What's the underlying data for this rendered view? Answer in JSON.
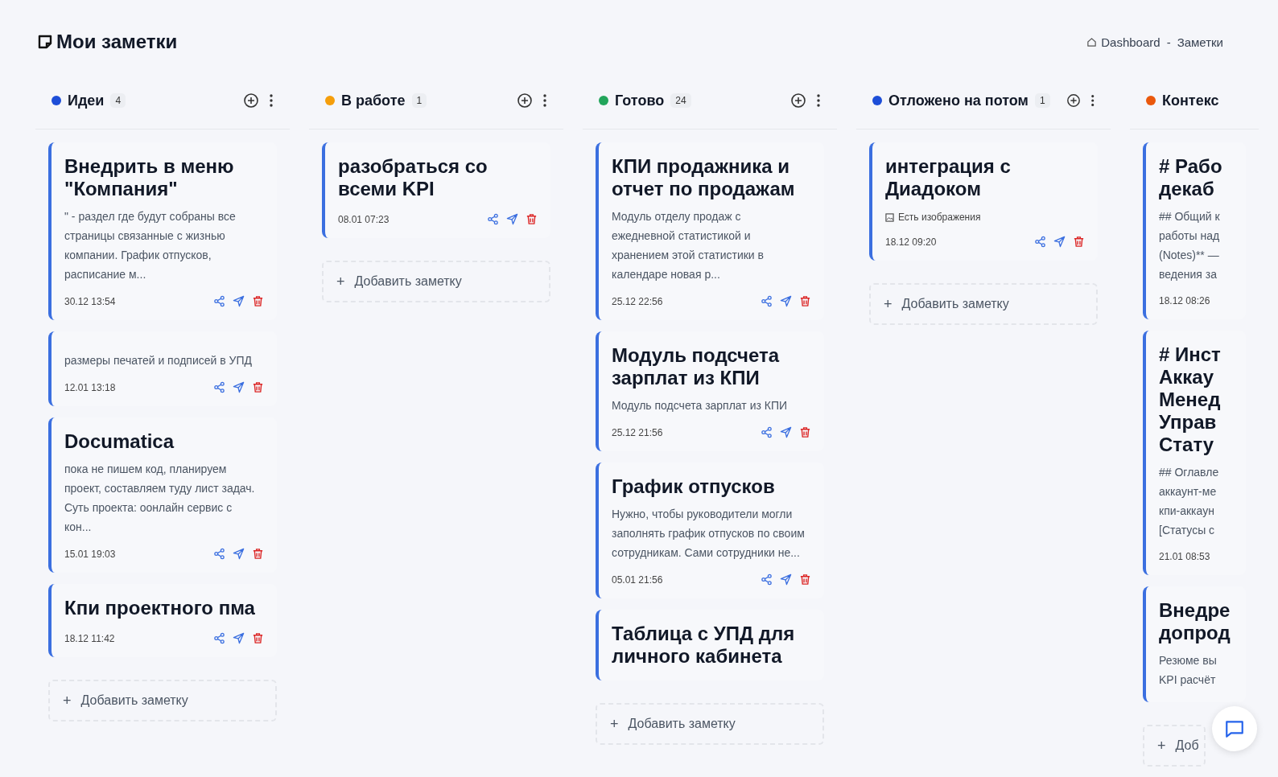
{
  "page": {
    "title": "Мои заметки"
  },
  "breadcrumb": [
    {
      "label": "Dashboard",
      "kind": "home"
    },
    {
      "label": "-",
      "kind": "separator"
    },
    {
      "label": "Заметки",
      "kind": "current"
    }
  ],
  "columns": [
    {
      "title": "Идеи",
      "count": "4",
      "color": "#1d4ed8",
      "add_label": "+",
      "add_text": "Добавить заметку",
      "cards": [
        {
          "title": "Внедрить в меню \"Компания\"",
          "preview": "\" - раздел где будут собраны все страницы связанные с жизнью компании. График отпусков, расписание м...",
          "date": "30.12 13:54",
          "actions": [
            {
              "kind": "share"
            },
            {
              "kind": "send"
            },
            {
              "kind": "delete"
            }
          ]
        },
        {
          "preview": "размеры печатей и подписей в УПД",
          "date": "12.01 13:18",
          "actions": [
            {
              "kind": "share"
            },
            {
              "kind": "send"
            },
            {
              "kind": "delete"
            }
          ]
        },
        {
          "title": "Documatica",
          "preview": "пока не пишем код, планируем проект, составляем туду лист задач. Суть проекта: оонлайн сервис с кон...",
          "date": "15.01 19:03",
          "actions": [
            {
              "kind": "share"
            },
            {
              "kind": "send"
            },
            {
              "kind": "delete"
            }
          ]
        },
        {
          "title": "Кпи проектного пма",
          "date": "18.12 11:42",
          "actions": [
            {
              "kind": "share"
            },
            {
              "kind": "send"
            },
            {
              "kind": "delete"
            }
          ]
        }
      ]
    },
    {
      "title": "В работе",
      "count": "1",
      "color": "#f59e0b",
      "add_label": "+",
      "add_text": "Добавить заметку",
      "cards": [
        {
          "title": "разобраться со всеми KPI",
          "date": "08.01 07:23",
          "actions": [
            {
              "kind": "share"
            },
            {
              "kind": "send"
            },
            {
              "kind": "delete"
            }
          ]
        }
      ]
    },
    {
      "title": "Готово",
      "count": "24",
      "color": "#22a55b",
      "add_label": "+",
      "add_text": "Добавить заметку",
      "cards": [
        {
          "title": "КПИ продажника и отчет по продажам",
          "preview": "Модуль отделу продаж с ежедневной статистикой и хранением этой статистики в календаре новая р...",
          "date": "25.12 22:56",
          "actions": [
            {
              "kind": "share"
            },
            {
              "kind": "send"
            },
            {
              "kind": "delete"
            }
          ]
        },
        {
          "title": "Модуль подсчета зарплат из КПИ",
          "preview": "Модуль подсчета зарплат из КПИ",
          "date": "25.12 21:56",
          "actions": [
            {
              "kind": "share"
            },
            {
              "kind": "send"
            },
            {
              "kind": "delete"
            }
          ]
        },
        {
          "title": "График отпусков",
          "preview": "Нужно, чтобы руководители могли заполнять график отпусков по своим сотрудникам. Сами сотрудники не...",
          "date": "05.01 21:56",
          "actions": [
            {
              "kind": "share"
            },
            {
              "kind": "send"
            },
            {
              "kind": "delete"
            }
          ]
        },
        {
          "title": "Таблица с УПД для личного кабинета"
        }
      ]
    },
    {
      "title": "Отложено на потом",
      "count": "1",
      "color": "#1d4ed8",
      "add_label": "+",
      "add_text": "Добавить заметку",
      "cards": [
        {
          "title": "интеграция с Диадоком",
          "images_note": "Есть изображения",
          "date": "18.12 09:20",
          "actions": [
            {
              "kind": "share"
            },
            {
              "kind": "send"
            },
            {
              "kind": "delete"
            }
          ]
        }
      ]
    },
    {
      "title": "Контекс",
      "color": "#ea580c",
      "add_label": "+",
      "add_text": "Доб",
      "cards": [
        {
          "title": "# Рабо\nдекаб",
          "preview": "## Общий к\nработы над\n(Notes)** —\nведения за",
          "date": "18.12 08:26"
        },
        {
          "title": "# Инст\nАккау\nМенед\nУправ\nСтату",
          "preview": "## Оглавле\nаккаунт-ме\nкпи-аккаун\n[Статусы с",
          "date": "21.01 08:53"
        },
        {
          "title": "Внедре\nдопрод",
          "preview": "Резюме вы\nKPI расчёт"
        }
      ]
    }
  ]
}
